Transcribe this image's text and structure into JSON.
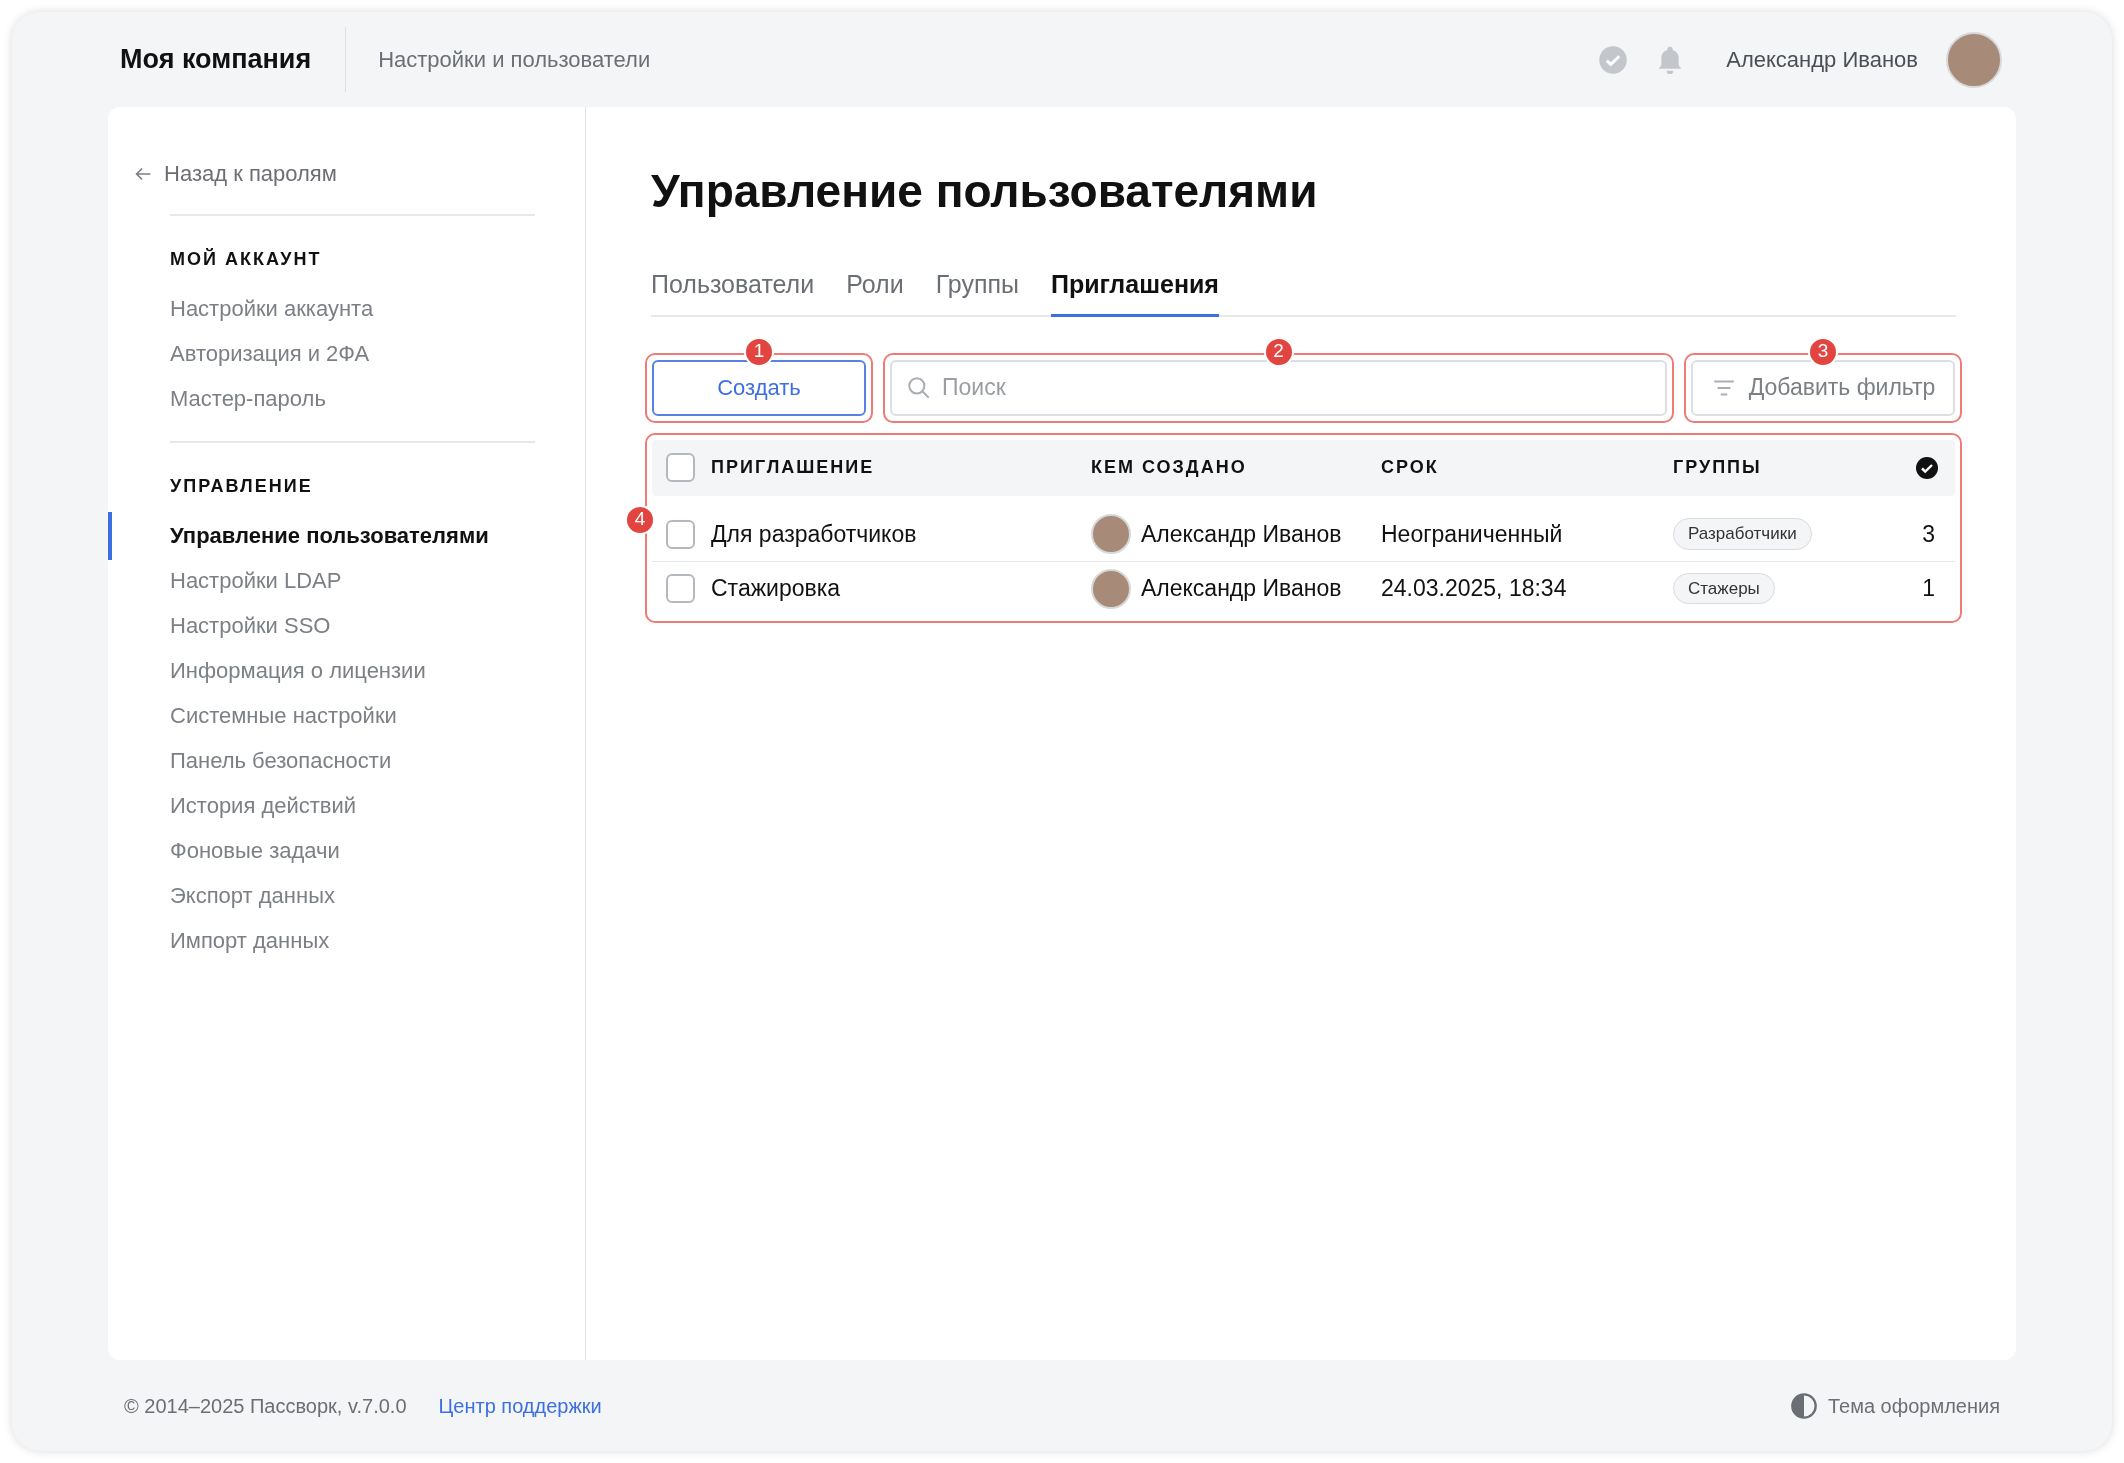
{
  "header": {
    "brand": "Моя компания",
    "section": "Настройки и пользователи",
    "user_name": "Александр Иванов"
  },
  "sidebar": {
    "back_link": "Назад к паролям",
    "groups": [
      {
        "title": "МОЙ АККАУНТ",
        "items": [
          {
            "label": "Настройки аккаунта",
            "selected": false
          },
          {
            "label": "Авторизация и 2ФА",
            "selected": false
          },
          {
            "label": "Мастер-пароль",
            "selected": false
          }
        ]
      },
      {
        "title": "УПРАВЛЕНИЕ",
        "items": [
          {
            "label": "Управление пользователями",
            "selected": true
          },
          {
            "label": "Настройки LDAP",
            "selected": false
          },
          {
            "label": "Настройки SSO",
            "selected": false
          },
          {
            "label": "Информация о лицензии",
            "selected": false
          },
          {
            "label": "Системные настройки",
            "selected": false
          },
          {
            "label": "Панель безопасности",
            "selected": false
          },
          {
            "label": "История действий",
            "selected": false
          },
          {
            "label": "Фоновые задачи",
            "selected": false
          },
          {
            "label": "Экспорт данных",
            "selected": false
          },
          {
            "label": "Импорт данных",
            "selected": false
          }
        ]
      }
    ]
  },
  "page": {
    "title": "Управление пользователями",
    "tabs": [
      {
        "label": "Пользователи",
        "selected": false
      },
      {
        "label": "Роли",
        "selected": false
      },
      {
        "label": "Группы",
        "selected": false
      },
      {
        "label": "Приглашения",
        "selected": true
      }
    ],
    "toolbar": {
      "create_button": {
        "label": "Создать",
        "callout": "1"
      },
      "search": {
        "placeholder": "Поиск",
        "callout": "2"
      },
      "filter_button": {
        "label": "Добавить фильтр",
        "callout": "3"
      }
    },
    "table": {
      "callout": "4",
      "select_all_checked": false,
      "columns": [
        "ПРИГЛАШЕНИЕ",
        "КЕМ СОЗДАНО",
        "СРОК",
        "ГРУППЫ"
      ],
      "rows": [
        {
          "checked": false,
          "name": "Для разработчиков",
          "creator": "Александр Иванов",
          "term": "Неограниченный",
          "group": "Разработчики",
          "count": "3"
        },
        {
          "checked": false,
          "name": "Стажировка",
          "creator": "Александр Иванов",
          "term": "24.03.2025, 18:34",
          "group": "Стажеры",
          "count": "1"
        }
      ]
    }
  },
  "footer": {
    "copyright": "© 2014–2025 Пассворк, v.7.0.0",
    "support_link": "Центр поддержки",
    "theme": "Тема оформления"
  }
}
